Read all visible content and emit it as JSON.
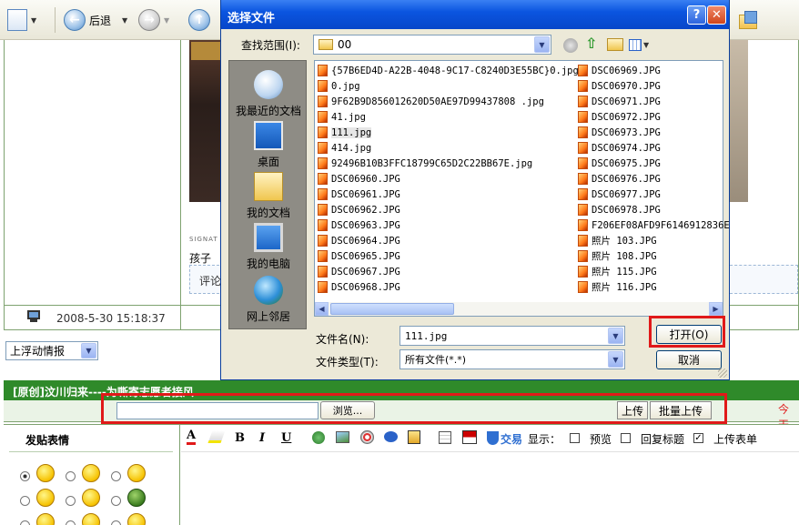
{
  "browser": {
    "back_label": "后退"
  },
  "page": {
    "signature_small": "SIGNAT",
    "child_text": "孩子",
    "comment_text": "评论",
    "timestamp": "2008-5-30 15:18:37",
    "board_select": "上浮动情报",
    "post_title": "[原创]汶川归来----为嘶寄志愿者接风",
    "browse_button": "浏览...",
    "upload_button": "上传",
    "batch_upload_button": "批量上传",
    "right_edge_text": "今天",
    "post_emoticons_label": "发贴表情",
    "editor": {
      "trade_label": "交易",
      "display_label": "显示：",
      "preview_label": "预览",
      "reply_title_label": "回复标题",
      "upload_form_label": "上传表单",
      "upload_form_checked": true
    }
  },
  "dialog": {
    "title": "选择文件",
    "look_in_label": "查找范围(I):",
    "look_in_value": "00",
    "places": [
      "我最近的文档",
      "桌面",
      "我的文档",
      "我的电脑",
      "网上邻居"
    ],
    "files_col1": [
      "{57B6ED4D-A22B-4048-9C17-C8240D3E55BC}0.jpg",
      "0.jpg",
      "9F62B9D856012620D50AE97D99437808 .jpg",
      "41.jpg",
      "111.jpg",
      "414.jpg",
      "92496B10B3FFC18799C65D2C22BB67E.jpg",
      "DSC06960.JPG",
      "DSC06961.JPG",
      "DSC06962.JPG",
      "DSC06963.JPG",
      "DSC06964.JPG",
      "DSC06965.JPG",
      "DSC06967.JPG",
      "DSC06968.JPG"
    ],
    "files_col2": [
      "DSC06969.JPG",
      "DSC06970.JPG",
      "DSC06971.JPG",
      "DSC06972.JPG",
      "DSC06973.JPG",
      "DSC06974.JPG",
      "DSC06975.JPG",
      "DSC06976.JPG",
      "DSC06977.JPG",
      "DSC06978.JPG",
      "F206EF08AFD9F6146912836E",
      "照片 103.JPG",
      "照片 108.JPG",
      "照片 115.JPG",
      "照片 116.JPG"
    ],
    "selected_file": "111.jpg",
    "filename_label": "文件名(N):",
    "filename_value": "111.jpg",
    "filetype_label": "文件类型(T):",
    "filetype_value": "所有文件(*.*)",
    "open_button": "打开(O)",
    "cancel_button": "取消",
    "help_glyph": "?",
    "close_glyph": "✕"
  },
  "colors": {
    "highlight_red": "#e01919",
    "title_blue": "#0b55e0",
    "forum_green": "#2f8a2a"
  }
}
